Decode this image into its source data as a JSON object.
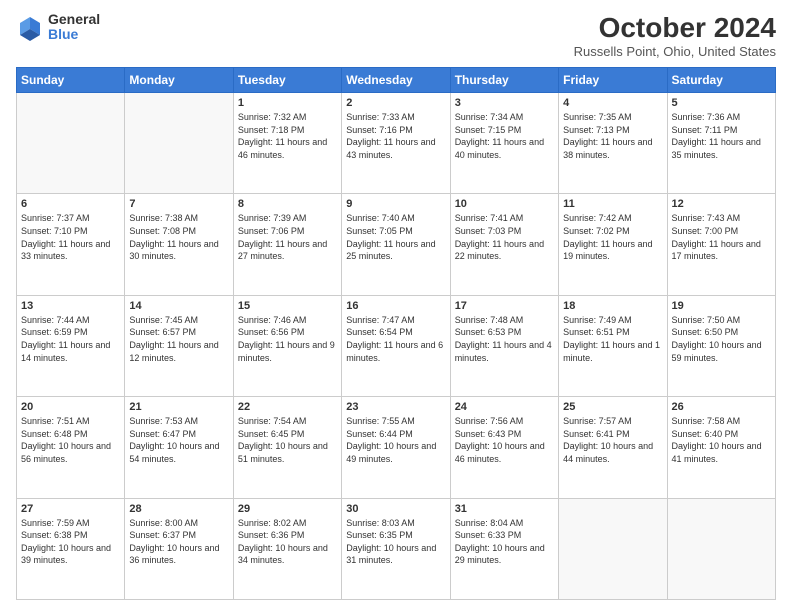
{
  "header": {
    "logo_general": "General",
    "logo_blue": "Blue",
    "title": "October 2024",
    "location": "Russells Point, Ohio, United States"
  },
  "days_of_week": [
    "Sunday",
    "Monday",
    "Tuesday",
    "Wednesday",
    "Thursday",
    "Friday",
    "Saturday"
  ],
  "weeks": [
    [
      {
        "day": "",
        "info": ""
      },
      {
        "day": "",
        "info": ""
      },
      {
        "day": "1",
        "info": "Sunrise: 7:32 AM\nSunset: 7:18 PM\nDaylight: 11 hours and 46 minutes."
      },
      {
        "day": "2",
        "info": "Sunrise: 7:33 AM\nSunset: 7:16 PM\nDaylight: 11 hours and 43 minutes."
      },
      {
        "day": "3",
        "info": "Sunrise: 7:34 AM\nSunset: 7:15 PM\nDaylight: 11 hours and 40 minutes."
      },
      {
        "day": "4",
        "info": "Sunrise: 7:35 AM\nSunset: 7:13 PM\nDaylight: 11 hours and 38 minutes."
      },
      {
        "day": "5",
        "info": "Sunrise: 7:36 AM\nSunset: 7:11 PM\nDaylight: 11 hours and 35 minutes."
      }
    ],
    [
      {
        "day": "6",
        "info": "Sunrise: 7:37 AM\nSunset: 7:10 PM\nDaylight: 11 hours and 33 minutes."
      },
      {
        "day": "7",
        "info": "Sunrise: 7:38 AM\nSunset: 7:08 PM\nDaylight: 11 hours and 30 minutes."
      },
      {
        "day": "8",
        "info": "Sunrise: 7:39 AM\nSunset: 7:06 PM\nDaylight: 11 hours and 27 minutes."
      },
      {
        "day": "9",
        "info": "Sunrise: 7:40 AM\nSunset: 7:05 PM\nDaylight: 11 hours and 25 minutes."
      },
      {
        "day": "10",
        "info": "Sunrise: 7:41 AM\nSunset: 7:03 PM\nDaylight: 11 hours and 22 minutes."
      },
      {
        "day": "11",
        "info": "Sunrise: 7:42 AM\nSunset: 7:02 PM\nDaylight: 11 hours and 19 minutes."
      },
      {
        "day": "12",
        "info": "Sunrise: 7:43 AM\nSunset: 7:00 PM\nDaylight: 11 hours and 17 minutes."
      }
    ],
    [
      {
        "day": "13",
        "info": "Sunrise: 7:44 AM\nSunset: 6:59 PM\nDaylight: 11 hours and 14 minutes."
      },
      {
        "day": "14",
        "info": "Sunrise: 7:45 AM\nSunset: 6:57 PM\nDaylight: 11 hours and 12 minutes."
      },
      {
        "day": "15",
        "info": "Sunrise: 7:46 AM\nSunset: 6:56 PM\nDaylight: 11 hours and 9 minutes."
      },
      {
        "day": "16",
        "info": "Sunrise: 7:47 AM\nSunset: 6:54 PM\nDaylight: 11 hours and 6 minutes."
      },
      {
        "day": "17",
        "info": "Sunrise: 7:48 AM\nSunset: 6:53 PM\nDaylight: 11 hours and 4 minutes."
      },
      {
        "day": "18",
        "info": "Sunrise: 7:49 AM\nSunset: 6:51 PM\nDaylight: 11 hours and 1 minute."
      },
      {
        "day": "19",
        "info": "Sunrise: 7:50 AM\nSunset: 6:50 PM\nDaylight: 10 hours and 59 minutes."
      }
    ],
    [
      {
        "day": "20",
        "info": "Sunrise: 7:51 AM\nSunset: 6:48 PM\nDaylight: 10 hours and 56 minutes."
      },
      {
        "day": "21",
        "info": "Sunrise: 7:53 AM\nSunset: 6:47 PM\nDaylight: 10 hours and 54 minutes."
      },
      {
        "day": "22",
        "info": "Sunrise: 7:54 AM\nSunset: 6:45 PM\nDaylight: 10 hours and 51 minutes."
      },
      {
        "day": "23",
        "info": "Sunrise: 7:55 AM\nSunset: 6:44 PM\nDaylight: 10 hours and 49 minutes."
      },
      {
        "day": "24",
        "info": "Sunrise: 7:56 AM\nSunset: 6:43 PM\nDaylight: 10 hours and 46 minutes."
      },
      {
        "day": "25",
        "info": "Sunrise: 7:57 AM\nSunset: 6:41 PM\nDaylight: 10 hours and 44 minutes."
      },
      {
        "day": "26",
        "info": "Sunrise: 7:58 AM\nSunset: 6:40 PM\nDaylight: 10 hours and 41 minutes."
      }
    ],
    [
      {
        "day": "27",
        "info": "Sunrise: 7:59 AM\nSunset: 6:38 PM\nDaylight: 10 hours and 39 minutes."
      },
      {
        "day": "28",
        "info": "Sunrise: 8:00 AM\nSunset: 6:37 PM\nDaylight: 10 hours and 36 minutes."
      },
      {
        "day": "29",
        "info": "Sunrise: 8:02 AM\nSunset: 6:36 PM\nDaylight: 10 hours and 34 minutes."
      },
      {
        "day": "30",
        "info": "Sunrise: 8:03 AM\nSunset: 6:35 PM\nDaylight: 10 hours and 31 minutes."
      },
      {
        "day": "31",
        "info": "Sunrise: 8:04 AM\nSunset: 6:33 PM\nDaylight: 10 hours and 29 minutes."
      },
      {
        "day": "",
        "info": ""
      },
      {
        "day": "",
        "info": ""
      }
    ]
  ]
}
